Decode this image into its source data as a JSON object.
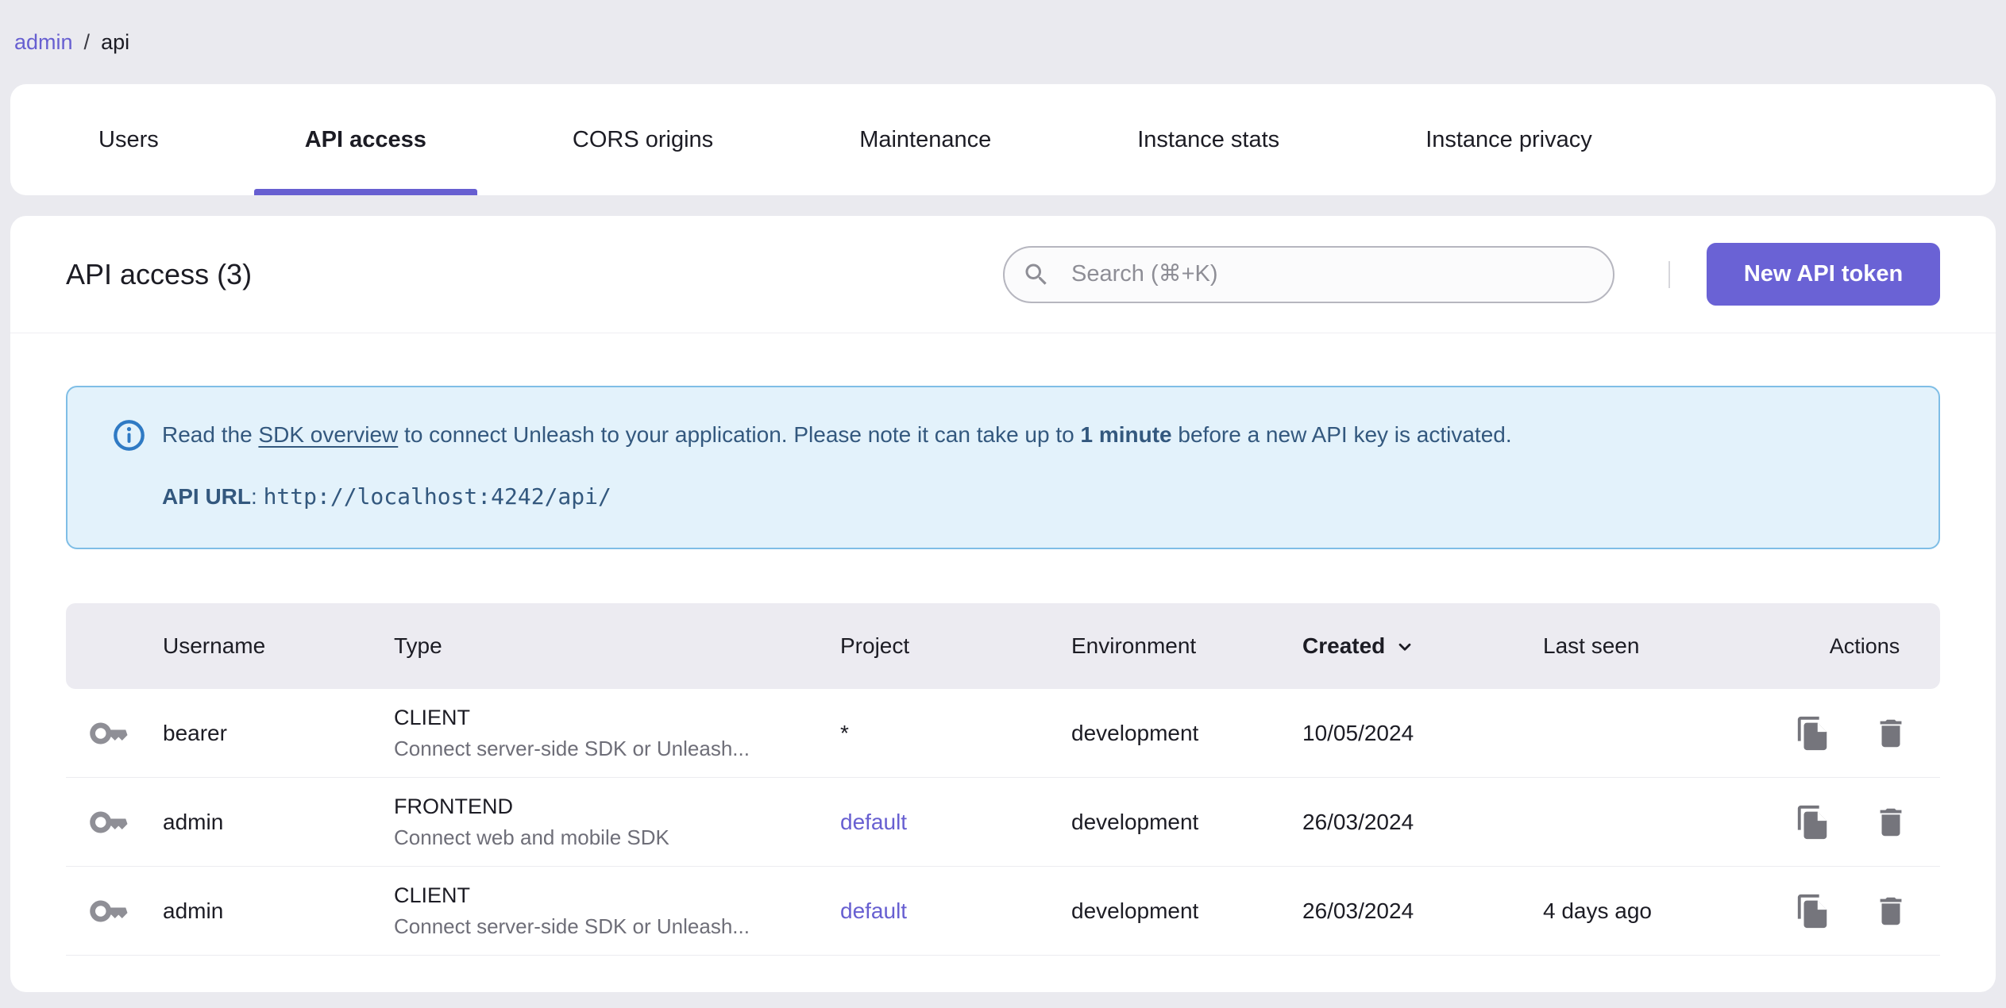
{
  "breadcrumb": {
    "separator": "/",
    "items": [
      {
        "label": "admin"
      },
      {
        "label": "api"
      }
    ]
  },
  "tabs": {
    "items": [
      {
        "label": "Users",
        "active": false
      },
      {
        "label": "API access",
        "active": true
      },
      {
        "label": "CORS origins",
        "active": false
      },
      {
        "label": "Maintenance",
        "active": false
      },
      {
        "label": "Instance stats",
        "active": false
      },
      {
        "label": "Instance privacy",
        "active": false
      }
    ]
  },
  "header": {
    "title": "API access (3)",
    "search_placeholder": "Search (⌘+K)",
    "new_token_button": "New API token"
  },
  "banner": {
    "text_prefix": "Read the ",
    "link_text": "SDK overview",
    "text_mid": " to connect Unleash to your application. Please note it can take up to ",
    "bold_text": "1 minute",
    "text_suffix": " before a new API key is activated.",
    "api_url_label": "API URL",
    "api_url_separator": ": ",
    "api_url": "http://localhost:4242/api/"
  },
  "table": {
    "columns": [
      "Username",
      "Type",
      "Project",
      "Environment",
      "Created",
      "Last seen",
      "Actions"
    ],
    "sorted_column": "Created",
    "sort_direction": "desc",
    "rows": [
      {
        "username": "bearer",
        "type": "CLIENT",
        "type_description": "Connect server-side SDK or Unleash...",
        "project": "*",
        "project_is_link": false,
        "environment": "development",
        "created": "10/05/2024",
        "last_seen": ""
      },
      {
        "username": "admin",
        "type": "FRONTEND",
        "type_description": "Connect web and mobile SDK",
        "project": "default",
        "project_is_link": true,
        "environment": "development",
        "created": "26/03/2024",
        "last_seen": ""
      },
      {
        "username": "admin",
        "type": "CLIENT",
        "type_description": "Connect server-side SDK or Unleash...",
        "project": "default",
        "project_is_link": true,
        "environment": "development",
        "created": "26/03/2024",
        "last_seen": "4 days ago"
      }
    ]
  },
  "colors": {
    "page_bg": "#EAEAEF",
    "accent_purple": "#675FD1",
    "button_purple": "#6A62D5",
    "banner_bg": "#E3F2FB",
    "banner_border": "#7FBEE6",
    "banner_text": "#33587E",
    "info_icon_blue": "#2F7AC4",
    "table_header_bg": "#ECEBF1",
    "icon_gray": "#8F8F96",
    "action_icon_gray": "#75757C",
    "subtext_gray": "#6E6E78"
  }
}
